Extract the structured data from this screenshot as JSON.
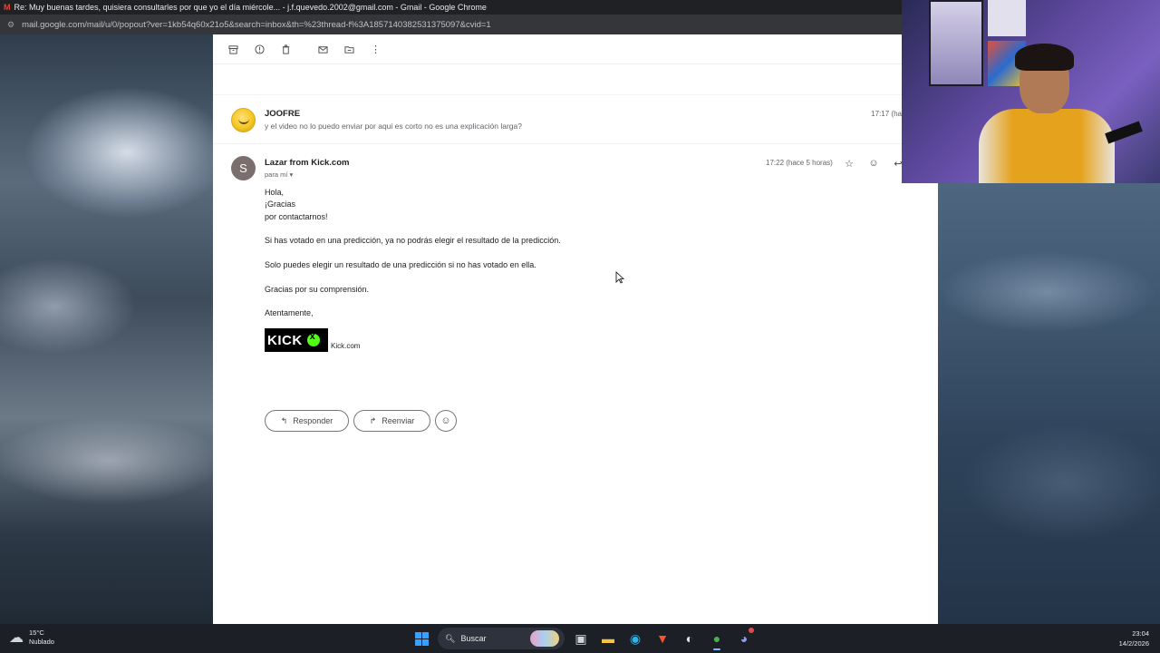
{
  "window": {
    "title": "Re: Muy buenas tardes, quisiera consultarles por que yo el día miércole... - j.f.quevedo.2002@gmail.com - Gmail - Google Chrome",
    "url": "mail.google.com/mail/u/0/popout?ver=1kb54q60x21o5&search=inbox&th=%23thread-f%3A1857140382531375097&cvid=1"
  },
  "toolbar": {
    "icons": [
      "archive-icon",
      "report-spam-icon",
      "delete-icon",
      "mark-unread-icon",
      "move-to-icon",
      "more-icon"
    ]
  },
  "messages": {
    "first": {
      "sender": "JOOFRE",
      "snippet": "y el video no lo puedo enviar por aqui es corto no es una explicación larga?",
      "time": "17:17 (hace 5 horas)"
    },
    "second": {
      "avatar_letter": "S",
      "sender": "Lazar from Kick.com",
      "to": "para mí",
      "time": "17:22 (hace 5 horas)",
      "body": {
        "line1": "Hola,",
        "line2": "¡Gracias",
        "line3": "por contactarnos!",
        "line4": "Si has votado en una predicción, ya no podrás elegir el resultado de la predicción.",
        "line5": "Solo puedes elegir un resultado de una predicción si no has votado en ella.",
        "line6": "Gracias por su comprensión.",
        "line7": "Atentamente,"
      },
      "logo_text": "KICK",
      "kick_link": "Kick.com"
    }
  },
  "actions": {
    "reply": "Responder",
    "forward": "Reenviar"
  },
  "taskbar": {
    "weather_temp": "15°C",
    "weather_desc": "Nublado",
    "search": "Buscar",
    "time": "23:04",
    "date": "14/2/2026"
  }
}
